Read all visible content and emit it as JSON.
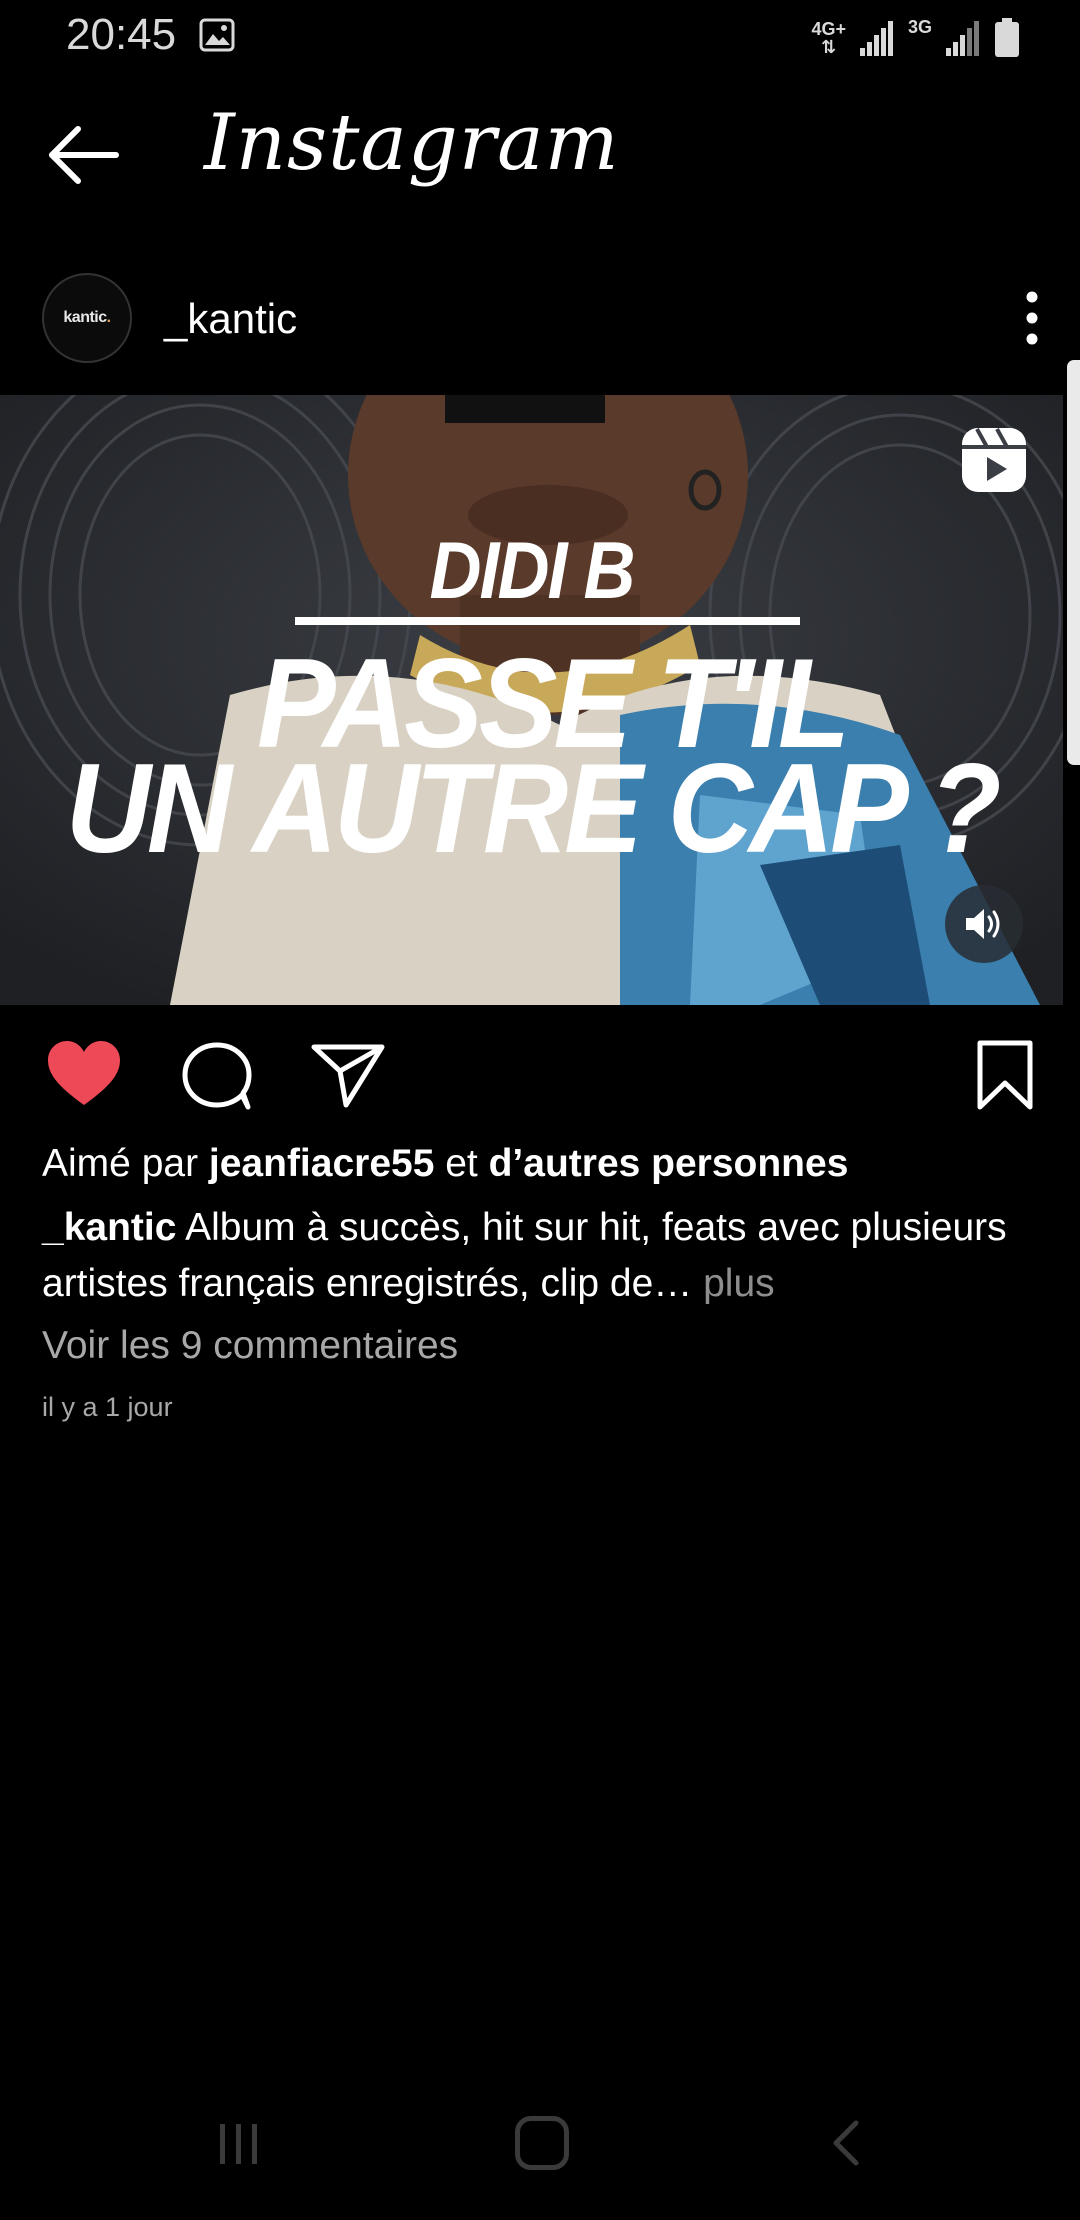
{
  "status_bar": {
    "time": "20:45",
    "network1": "4G+",
    "network2": "3G",
    "icons": [
      "image-icon",
      "signal-icon",
      "battery-icon"
    ]
  },
  "header": {
    "title": "Instagram",
    "back_icon": "arrow-left-icon"
  },
  "post": {
    "avatar_text": "kantic",
    "avatar_dot": ".",
    "username": "_kantic",
    "more_icon": "vertical-ellipsis-icon",
    "media": {
      "line1": "DIDI B",
      "line2": "PASSE T'IL",
      "line3": "UN AUTRE CAP ?",
      "reel_icon": "reels-icon",
      "sound_icon": "volume-icon"
    },
    "actions": {
      "like_icon": "heart-filled-icon",
      "comment_icon": "comment-icon",
      "share_icon": "send-icon",
      "save_icon": "bookmark-icon",
      "like_color": "#ed4956"
    },
    "likes": {
      "prefix": "Aimé par ",
      "user": "jeanfiacre55",
      "middle": " et ",
      "others": "d’autres personnes"
    },
    "caption": {
      "user": "_kantic",
      "text": " Album à succès, hit sur hit, feats avec plusieurs artistes français enregistrés, clip de…",
      "more": " plus"
    },
    "view_comments": "Voir les 9 commentaires",
    "timestamp": "il y a 1 jour"
  },
  "nav": {
    "recent_icon": "recent-apps-icon",
    "home_icon": "home-icon",
    "back_icon": "back-chevron-icon"
  }
}
